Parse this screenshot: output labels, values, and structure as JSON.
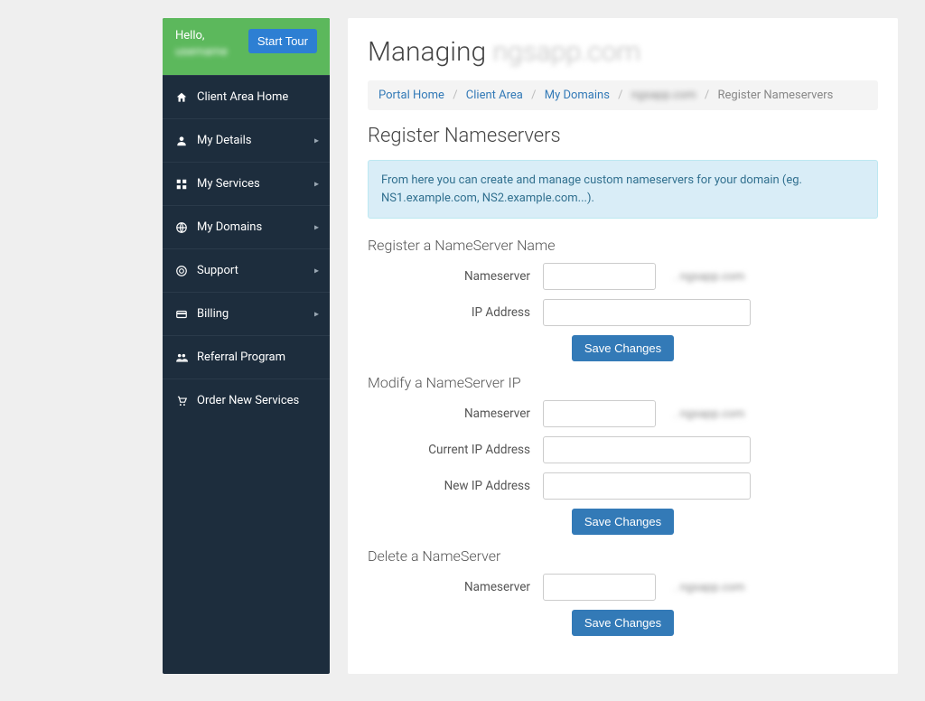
{
  "sidebar": {
    "hello": "Hello,",
    "user": "username",
    "tour_btn": "Start Tour",
    "items": [
      {
        "id": "client-home",
        "label": "Client Area Home",
        "icon": "home",
        "expandable": false
      },
      {
        "id": "my-details",
        "label": "My Details",
        "icon": "user",
        "expandable": true
      },
      {
        "id": "my-services",
        "label": "My Services",
        "icon": "grid",
        "expandable": true
      },
      {
        "id": "my-domains",
        "label": "My Domains",
        "icon": "globe",
        "expandable": true
      },
      {
        "id": "support",
        "label": "Support",
        "icon": "life",
        "expandable": true
      },
      {
        "id": "billing",
        "label": "Billing",
        "icon": "card",
        "expandable": true
      },
      {
        "id": "referral",
        "label": "Referral Program",
        "icon": "people",
        "expandable": false
      },
      {
        "id": "order-services",
        "label": "Order New Services",
        "icon": "cart",
        "expandable": false
      }
    ]
  },
  "heading": {
    "prefix": "Managing ",
    "domain": "ngsapp.com"
  },
  "breadcrumb": {
    "items": [
      {
        "label": "Portal Home",
        "link": true
      },
      {
        "label": "Client Area",
        "link": true
      },
      {
        "label": "My Domains",
        "link": true
      },
      {
        "label": "ngsapp.com",
        "link": true,
        "blur": true
      },
      {
        "label": "Register Nameservers",
        "link": false
      }
    ]
  },
  "page_title": "Register Nameservers",
  "info_text": "From here you can create and manage custom nameservers for your domain (eg. NS1.example.com, NS2.example.com...).",
  "sections": {
    "register": {
      "title": "Register a NameServer Name",
      "ns_label": "Nameserver",
      "suffix": ". ngsapp.com",
      "ip_label": "IP Address",
      "save": "Save Changes"
    },
    "modify": {
      "title": "Modify a NameServer IP",
      "ns_label": "Nameserver",
      "suffix": ". ngsapp.com",
      "cur_ip_label": "Current IP Address",
      "new_ip_label": "New IP Address",
      "save": "Save Changes"
    },
    "delete": {
      "title": "Delete a NameServer",
      "ns_label": "Nameserver",
      "suffix": ". ngsapp.com",
      "save": "Save Changes"
    }
  }
}
